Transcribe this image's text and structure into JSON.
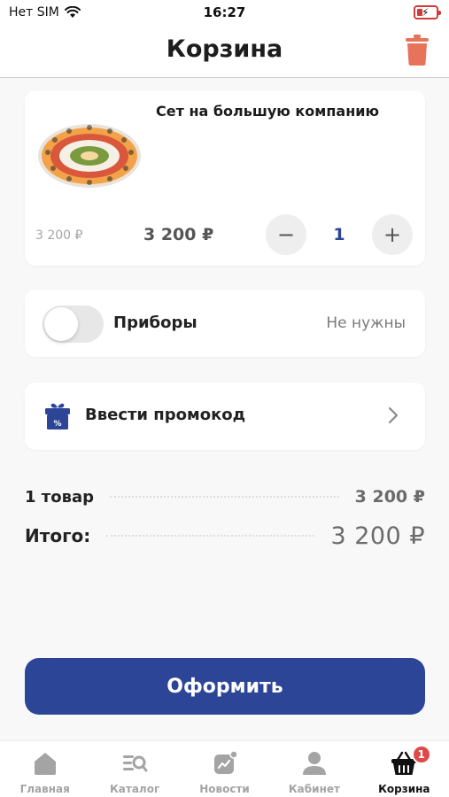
{
  "status_bar": {
    "carrier": "Нет SIM",
    "time": "16:27"
  },
  "header": {
    "title": "Корзина"
  },
  "cart_item": {
    "title": "Сет на большую компанию",
    "old_price": "3 200 ₽",
    "price": "3 200 ₽",
    "quantity": "1",
    "minus_label": "−",
    "plus_label": "+"
  },
  "utensils": {
    "label": "Приборы",
    "value": "Не нужны",
    "enabled": false
  },
  "promo": {
    "label": "Ввести промокод"
  },
  "summary": {
    "items_label": "1 товар",
    "items_value": "3 200 ₽",
    "total_label": "Итого:",
    "total_value": "3 200 ₽"
  },
  "checkout": {
    "label": "Оформить"
  },
  "tabs": [
    {
      "label": "Главная",
      "icon": "home-icon"
    },
    {
      "label": "Каталог",
      "icon": "catalog-icon"
    },
    {
      "label": "Новости",
      "icon": "news-icon"
    },
    {
      "label": "Кабинет",
      "icon": "profile-icon"
    },
    {
      "label": "Корзина",
      "icon": "basket-icon",
      "active": true,
      "badge": "1"
    }
  ],
  "colors": {
    "accent": "#2c4597",
    "trash": "#e8735b",
    "badge": "#e04848",
    "inactive_tab": "#a4a4a4"
  }
}
